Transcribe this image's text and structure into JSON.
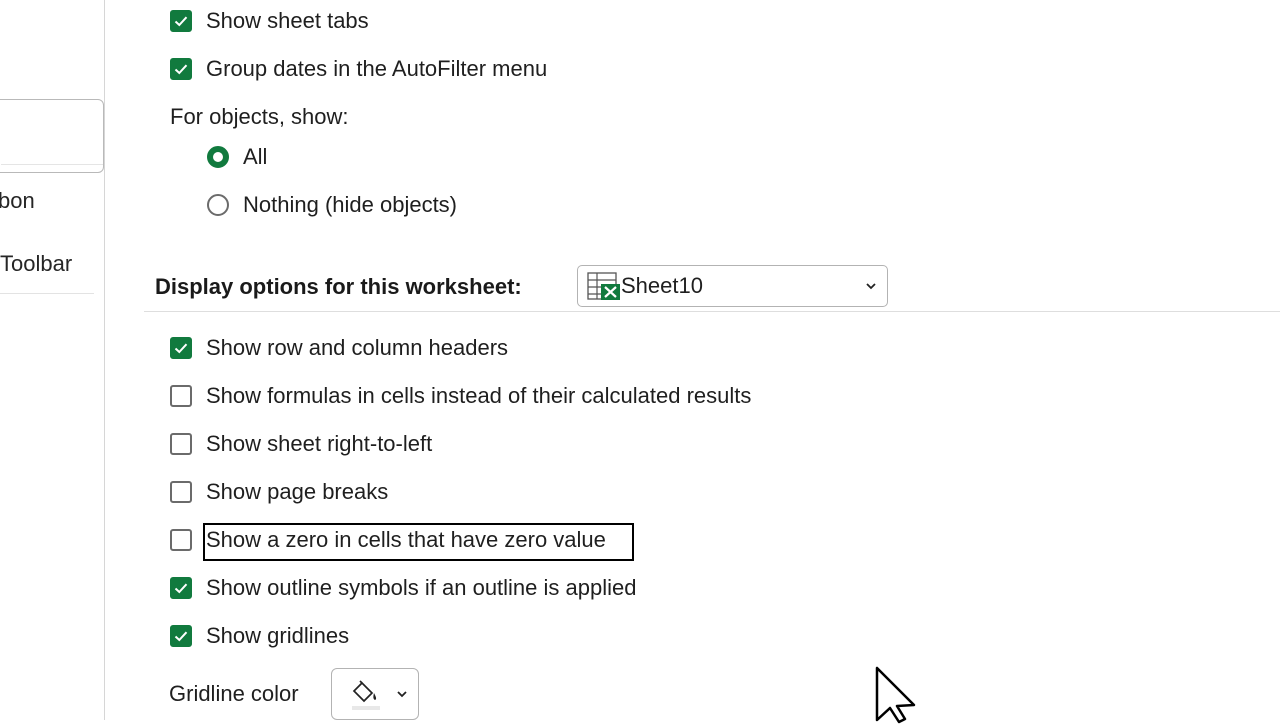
{
  "sidebar": {
    "items": [
      {
        "label": "bon"
      },
      {
        "label": "Toolbar"
      }
    ]
  },
  "workbook_options": {
    "show_sheet_tabs": {
      "label": "Show sheet tabs",
      "checked": true
    },
    "group_dates": {
      "label": "Group dates in the AutoFilter menu",
      "checked": true
    },
    "objects_heading": "For objects, show:",
    "objects_all": {
      "label": "All",
      "selected": true
    },
    "objects_nothing": {
      "label": "Nothing (hide objects)",
      "selected": false
    }
  },
  "worksheet_options": {
    "heading": "Display options for this worksheet:",
    "sheet_select": {
      "value": "Sheet10"
    },
    "items": [
      {
        "label": "Show row and column headers",
        "checked": true
      },
      {
        "label": "Show formulas in cells instead of their calculated results",
        "checked": false
      },
      {
        "label": "Show sheet right-to-left",
        "checked": false
      },
      {
        "label": "Show page breaks",
        "checked": false
      },
      {
        "label": "Show a zero in cells that have zero value",
        "checked": false
      },
      {
        "label": "Show outline symbols if an outline is applied",
        "checked": true
      },
      {
        "label": "Show gridlines",
        "checked": true
      }
    ],
    "gridline_color_label": "Gridline color"
  },
  "colors": {
    "accent": "#117a3e",
    "checkbox_border": "#6b6b6b"
  },
  "icons": [
    "checkmark-icon",
    "sheet-icon",
    "chevron-down-icon",
    "paint-bucket-icon",
    "mouse-cursor-icon"
  ]
}
